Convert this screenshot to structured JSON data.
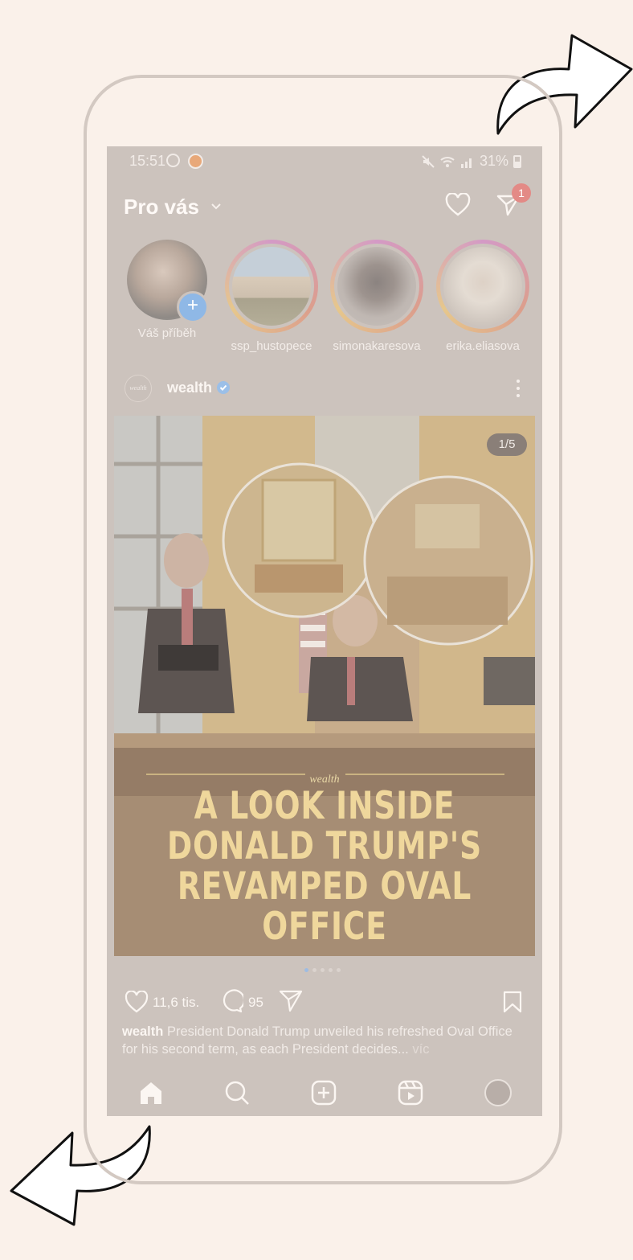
{
  "status_bar": {
    "time": "15:51",
    "battery": "31%"
  },
  "header": {
    "title": "Pro vás",
    "notification_badge": "1"
  },
  "stories": [
    {
      "label": "Váš příběh",
      "own": true
    },
    {
      "label": "ssp_hustopece",
      "own": false
    },
    {
      "label": "simonakaresova",
      "own": false
    },
    {
      "label": "erika.eliasova",
      "own": false
    }
  ],
  "post": {
    "username": "wealth",
    "avatar_text": "wealth",
    "image_counter": "1/5",
    "image_brand": "wealth",
    "image_headline": [
      "A LOOK INSIDE",
      "DONALD TRUMP'S",
      "REVAMPED OVAL OFFICE"
    ],
    "carousel_total": 5,
    "carousel_active": 1,
    "likes": "11,6 tis.",
    "comments": "95",
    "caption_user": "wealth",
    "caption_text": "President Donald Trump unveiled his refreshed Oval Office for his second term, as each President decides...",
    "caption_more": "víc"
  },
  "icons": {
    "header": [
      "chevron-down-icon",
      "heart-icon",
      "send-icon"
    ],
    "post_actions": [
      "heart-icon",
      "comment-icon",
      "share-icon",
      "bookmark-icon"
    ],
    "bottom_nav": [
      "home-icon",
      "search-icon",
      "create-icon",
      "reels-icon",
      "profile-avatar"
    ]
  },
  "colors": {
    "page_background": "#faf1ea",
    "screen_background": "#ccc3bd",
    "headline": "#efd79c",
    "badge": "#e38a86",
    "verified": "#9bbfe8"
  }
}
